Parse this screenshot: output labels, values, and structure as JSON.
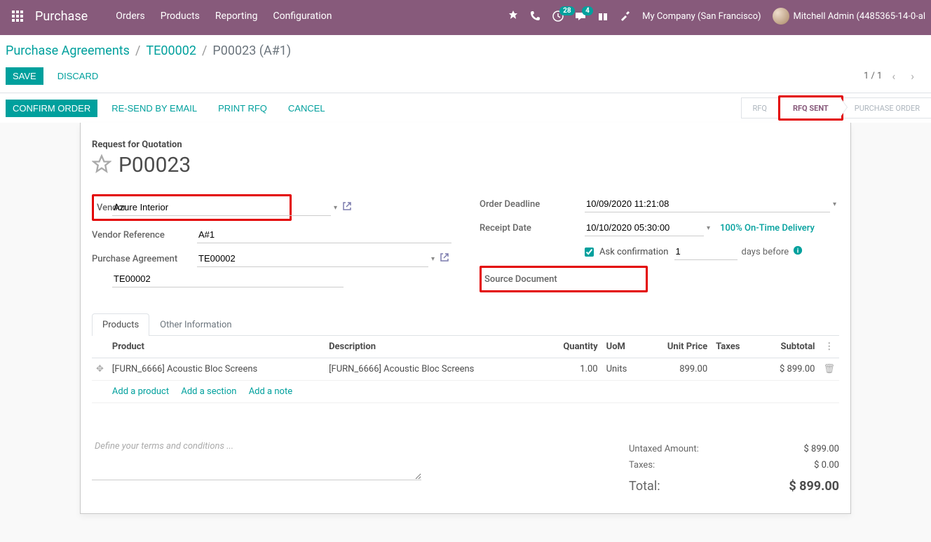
{
  "navbar": {
    "brand": "Purchase",
    "menu": [
      "Orders",
      "Products",
      "Reporting",
      "Configuration"
    ],
    "badge_clock": "28",
    "badge_chat": "4",
    "company": "My Company (San Francisco)",
    "user": "Mitchell Admin (4485365-14-0-al"
  },
  "breadcrumb": {
    "root": "Purchase Agreements",
    "mid": "TE00002",
    "current": "P00023 (A#1)"
  },
  "buttons": {
    "save": "Save",
    "discard": "Discard",
    "confirm": "Confirm Order",
    "resend": "Re-send by Email",
    "print": "Print RFQ",
    "cancel": "Cancel"
  },
  "pager": {
    "text": "1 / 1"
  },
  "status": {
    "rfq": "RFQ",
    "rfq_sent": "RFQ Sent",
    "po": "Purchase Order"
  },
  "header": {
    "subtitle": "Request for Quotation",
    "title": "P00023"
  },
  "fields": {
    "vendor_label": "Vendor",
    "vendor": "Azure Interior",
    "vendor_ref_label": "Vendor Reference",
    "vendor_ref": "A#1",
    "agreement_label": "Purchase Agreement",
    "agreement": "TE00002",
    "deadline_label": "Order Deadline",
    "deadline": "10/09/2020 11:21:08",
    "receipt_label": "Receipt Date",
    "receipt": "10/10/2020 05:30:00",
    "ontime": "100% On-Time Delivery",
    "ask_conf": "Ask confirmation",
    "ask_days": "1",
    "days_before": "days before",
    "source_label": "Source Document",
    "source": "TE00002"
  },
  "tabs": {
    "products": "Products",
    "other": "Other Information"
  },
  "table": {
    "cols": {
      "product": "Product",
      "desc": "Description",
      "qty": "Quantity",
      "uom": "UoM",
      "price": "Unit Price",
      "taxes": "Taxes",
      "subtotal": "Subtotal"
    },
    "rows": [
      {
        "product": "[FURN_6666] Acoustic Bloc Screens",
        "desc": "[FURN_6666] Acoustic Bloc Screens",
        "qty": "1.00",
        "uom": "Units",
        "price": "899.00",
        "taxes": "",
        "subtotal": "$ 899.00"
      }
    ],
    "add_product": "Add a product",
    "add_section": "Add a section",
    "add_note": "Add a note"
  },
  "terms_placeholder": "Define your terms and conditions ...",
  "totals": {
    "untaxed_lbl": "Untaxed Amount:",
    "untaxed": "$ 899.00",
    "taxes_lbl": "Taxes:",
    "taxes": "$ 0.00",
    "total_lbl": "Total:",
    "total": "$ 899.00"
  }
}
